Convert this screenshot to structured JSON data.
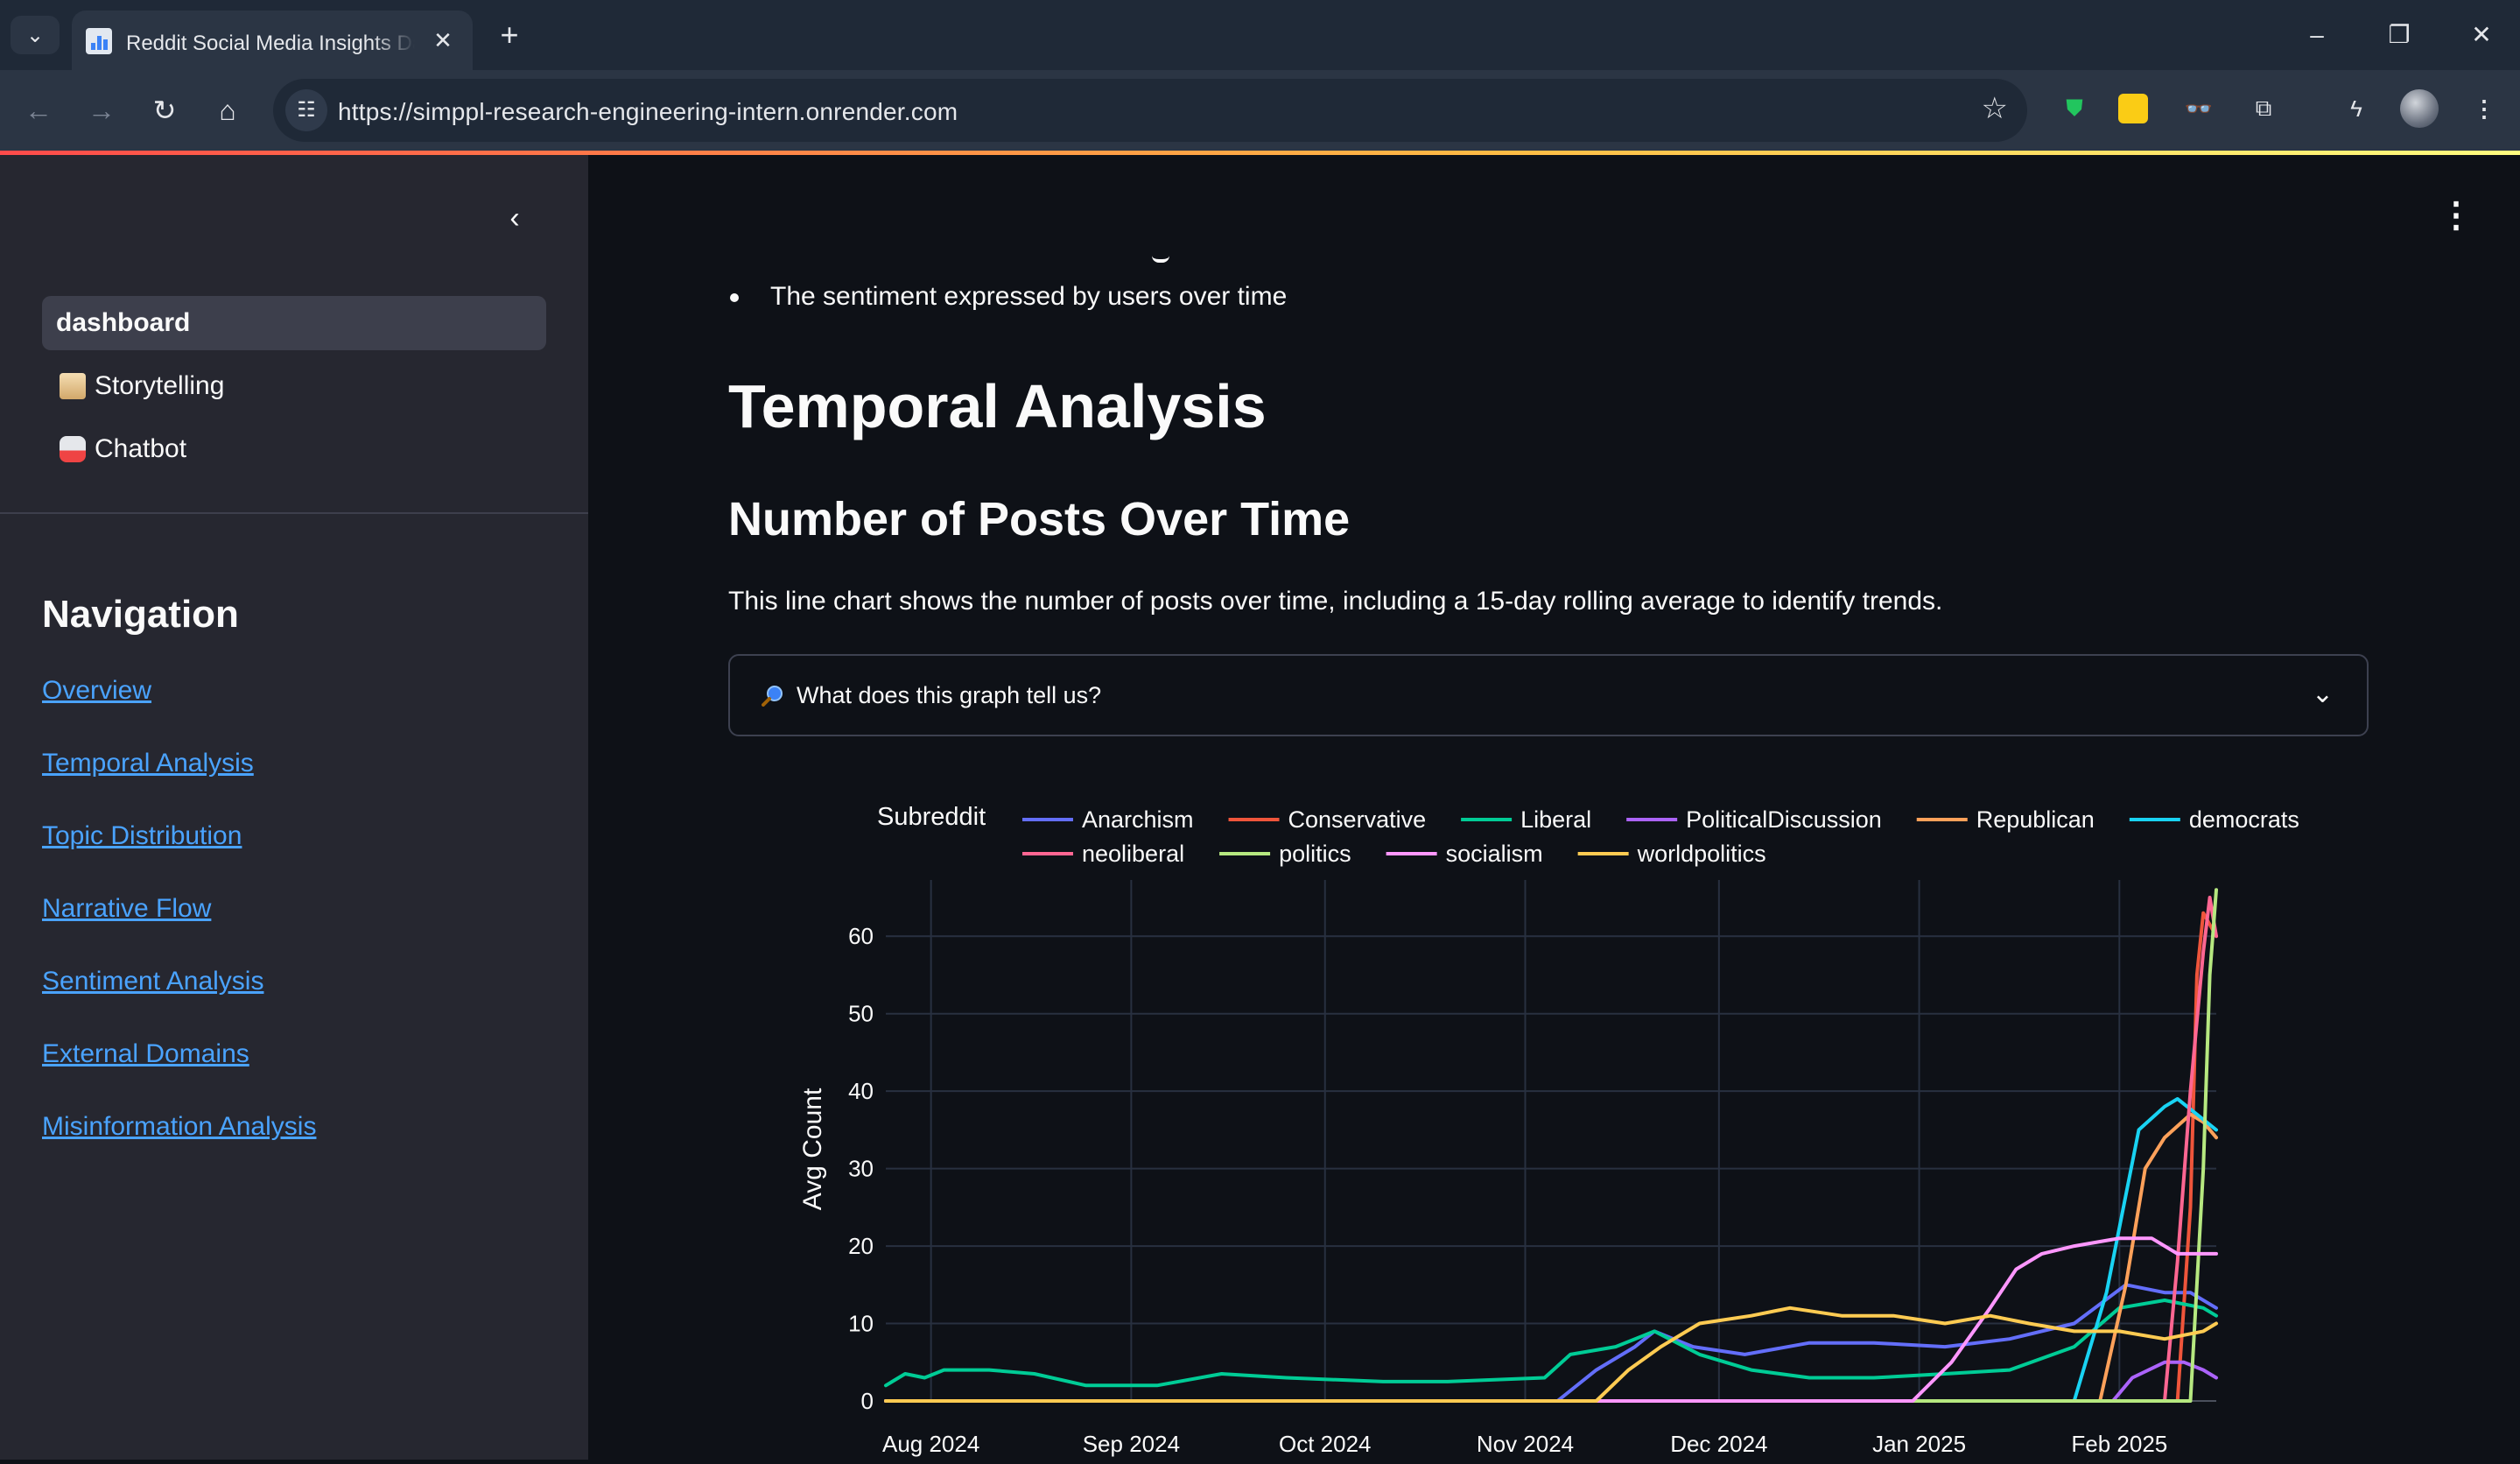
{
  "browser": {
    "tab_title": "Reddit Social Media Insights Dashboard",
    "url": "https://simppl-research-engineering-intern.onrender.com",
    "icons": {
      "tab_list": "chevron-down-icon",
      "close": "close-icon",
      "new_tab": "plus-icon",
      "back": "arrow-left-icon",
      "forward": "arrow-right-icon",
      "reload": "reload-icon",
      "home": "home-icon",
      "site_info": "tune-icon",
      "bookmark": "star-icon",
      "minimize": "minimize-icon",
      "restore": "restore-icon",
      "window_close": "close-icon"
    },
    "extensions": [
      "shield-extension-icon",
      "note-extension-icon",
      "glasses-extension-icon",
      "puzzle-extension-icon",
      "flash-extension-icon",
      "profile-avatar"
    ]
  },
  "sidebar": {
    "pages": [
      {
        "label": "dashboard",
        "active": true
      },
      {
        "label": "Storytelling",
        "icon": "scroll-emoji-icon"
      },
      {
        "label": "Chatbot",
        "icon": "robot-emoji-icon"
      }
    ],
    "nav_title": "Navigation",
    "nav_links": [
      "Overview",
      "Temporal Analysis",
      "Topic Distribution",
      "Narrative Flow",
      "Sentiment Analysis",
      "External Domains",
      "Misinformation Analysis"
    ]
  },
  "main": {
    "bullet": "The sentiment expressed by users over time",
    "h1": "Temporal Analysis",
    "h2": "Number of Posts Over Time",
    "description": "This line chart shows the number of posts over time, including a 15-day rolling average to identify trends.",
    "expander_label": "What does this graph tell us?",
    "expander_icon": "magnifier-emoji-icon"
  },
  "colors": {
    "accent_link": "#4aa3ff",
    "background": "#0e1117",
    "sidebar": "#262730"
  },
  "chart_data": {
    "type": "line",
    "legend_title": "Subreddit",
    "legend_placement": "top",
    "ylabel": "Avg Count",
    "ylim": [
      0,
      65
    ],
    "yticks": [
      0,
      10,
      20,
      30,
      40,
      50,
      60
    ],
    "xlim": [
      "2024-07-25",
      "2025-02-16"
    ],
    "xticks": [
      {
        "label": "Aug 2024",
        "date": "2024-08-01"
      },
      {
        "label": "Sep 2024",
        "date": "2024-09-01"
      },
      {
        "label": "Oct 2024",
        "date": "2024-10-01"
      },
      {
        "label": "Nov 2024",
        "date": "2024-11-01"
      },
      {
        "label": "Dec 2024",
        "date": "2024-12-01"
      },
      {
        "label": "Jan 2025",
        "date": "2025-01-01"
      },
      {
        "label": "Feb 2025",
        "date": "2025-02-01"
      }
    ],
    "grid": true,
    "series": [
      {
        "name": "Anarchism",
        "color": "#636efa",
        "points": [
          [
            "2024-07-25",
            0
          ],
          [
            "2024-11-06",
            0
          ],
          [
            "2024-11-12",
            4
          ],
          [
            "2024-11-18",
            7
          ],
          [
            "2024-11-21",
            9
          ],
          [
            "2024-11-27",
            7
          ],
          [
            "2024-12-05",
            6
          ],
          [
            "2024-12-15",
            7.5
          ],
          [
            "2024-12-25",
            7.5
          ],
          [
            "2025-01-05",
            7
          ],
          [
            "2025-01-15",
            8
          ],
          [
            "2025-01-25",
            10
          ],
          [
            "2025-02-02",
            15
          ],
          [
            "2025-02-08",
            14
          ],
          [
            "2025-02-12",
            14
          ],
          [
            "2025-02-16",
            12
          ]
        ]
      },
      {
        "name": "Conservative",
        "color": "#ef553b",
        "points": [
          [
            "2024-07-25",
            0
          ],
          [
            "2025-02-10",
            0
          ],
          [
            "2025-02-12",
            25
          ],
          [
            "2025-02-13",
            55
          ],
          [
            "2025-02-14",
            63
          ],
          [
            "2025-02-16",
            60
          ]
        ]
      },
      {
        "name": "Liberal",
        "color": "#00cc96",
        "points": [
          [
            "2024-07-25",
            2
          ],
          [
            "2024-07-28",
            3.5
          ],
          [
            "2024-07-31",
            3
          ],
          [
            "2024-08-03",
            4
          ],
          [
            "2024-08-10",
            4
          ],
          [
            "2024-08-17",
            3.5
          ],
          [
            "2024-08-25",
            2
          ],
          [
            "2024-09-05",
            2
          ],
          [
            "2024-09-15",
            3.5
          ],
          [
            "2024-09-25",
            3
          ],
          [
            "2024-10-10",
            2.5
          ],
          [
            "2024-10-20",
            2.5
          ],
          [
            "2024-11-04",
            3
          ],
          [
            "2024-11-08",
            6
          ],
          [
            "2024-11-15",
            7
          ],
          [
            "2024-11-21",
            9
          ],
          [
            "2024-11-28",
            6
          ],
          [
            "2024-12-06",
            4
          ],
          [
            "2024-12-15",
            3
          ],
          [
            "2024-12-25",
            3
          ],
          [
            "2025-01-05",
            3.5
          ],
          [
            "2025-01-15",
            4
          ],
          [
            "2025-01-25",
            7
          ],
          [
            "2025-02-01",
            12
          ],
          [
            "2025-02-08",
            13
          ],
          [
            "2025-02-14",
            12
          ],
          [
            "2025-02-16",
            11
          ]
        ]
      },
      {
        "name": "PoliticalDiscussion",
        "color": "#ab63fa",
        "points": [
          [
            "2024-07-25",
            0
          ],
          [
            "2025-01-31",
            0
          ],
          [
            "2025-02-03",
            3
          ],
          [
            "2025-02-08",
            5
          ],
          [
            "2025-02-11",
            5
          ],
          [
            "2025-02-14",
            4
          ],
          [
            "2025-02-16",
            3
          ]
        ]
      },
      {
        "name": "Republican",
        "color": "#ffa15a",
        "points": [
          [
            "2024-07-25",
            0
          ],
          [
            "2025-01-29",
            0
          ],
          [
            "2025-02-02",
            15
          ],
          [
            "2025-02-05",
            30
          ],
          [
            "2025-02-08",
            34
          ],
          [
            "2025-02-12",
            37
          ],
          [
            "2025-02-14",
            36
          ],
          [
            "2025-02-16",
            34
          ]
        ]
      },
      {
        "name": "democrats",
        "color": "#19d3f3",
        "points": [
          [
            "2024-07-25",
            0
          ],
          [
            "2025-01-25",
            0
          ],
          [
            "2025-01-30",
            14
          ],
          [
            "2025-02-04",
            35
          ],
          [
            "2025-02-08",
            38
          ],
          [
            "2025-02-10",
            39
          ],
          [
            "2025-02-13",
            37
          ],
          [
            "2025-02-16",
            35
          ]
        ]
      },
      {
        "name": "neoliberal",
        "color": "#ff6692",
        "points": [
          [
            "2024-07-25",
            0
          ],
          [
            "2025-02-08",
            0
          ],
          [
            "2025-02-10",
            18
          ],
          [
            "2025-02-12",
            40
          ],
          [
            "2025-02-14",
            58
          ],
          [
            "2025-02-15",
            65
          ],
          [
            "2025-02-16",
            60
          ]
        ]
      },
      {
        "name": "politics",
        "color": "#b6e880",
        "points": [
          [
            "2024-07-25",
            0
          ],
          [
            "2025-02-12",
            0
          ],
          [
            "2025-02-14",
            30
          ],
          [
            "2025-02-15",
            55
          ],
          [
            "2025-02-16",
            66
          ]
        ]
      },
      {
        "name": "socialism",
        "color": "#ff97ff",
        "points": [
          [
            "2024-07-25",
            0
          ],
          [
            "2024-12-31",
            0
          ],
          [
            "2025-01-06",
            5
          ],
          [
            "2025-01-12",
            12
          ],
          [
            "2025-01-16",
            17
          ],
          [
            "2025-01-20",
            19
          ],
          [
            "2025-01-25",
            20
          ],
          [
            "2025-02-01",
            21
          ],
          [
            "2025-02-06",
            21
          ],
          [
            "2025-02-10",
            19
          ],
          [
            "2025-02-16",
            19
          ]
        ]
      },
      {
        "name": "worldpolitics",
        "color": "#fecb52",
        "points": [
          [
            "2024-07-25",
            0
          ],
          [
            "2024-11-12",
            0
          ],
          [
            "2024-11-17",
            4
          ],
          [
            "2024-11-22",
            7
          ],
          [
            "2024-11-28",
            10
          ],
          [
            "2024-12-06",
            11
          ],
          [
            "2024-12-12",
            12
          ],
          [
            "2024-12-20",
            11
          ],
          [
            "2024-12-28",
            11
          ],
          [
            "2025-01-05",
            10
          ],
          [
            "2025-01-12",
            11
          ],
          [
            "2025-01-18",
            10
          ],
          [
            "2025-01-25",
            9
          ],
          [
            "2025-02-01",
            9
          ],
          [
            "2025-02-08",
            8
          ],
          [
            "2025-02-14",
            9
          ],
          [
            "2025-02-16",
            10
          ]
        ]
      }
    ]
  }
}
